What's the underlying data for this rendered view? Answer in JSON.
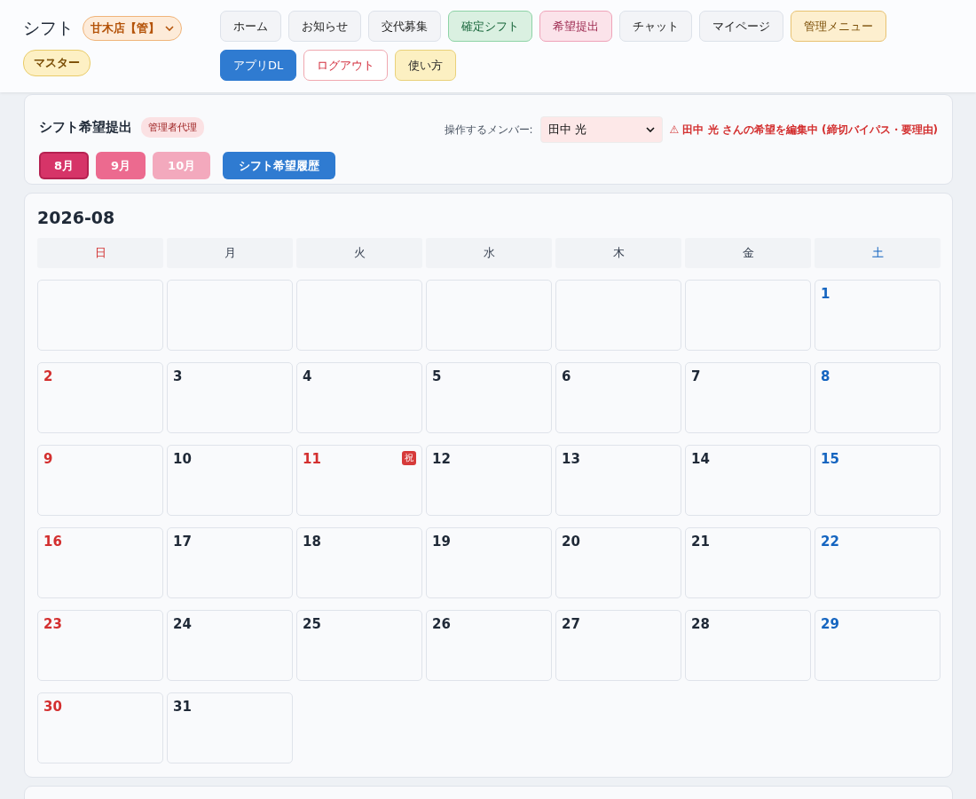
{
  "header": {
    "title": "シフト",
    "store_select": {
      "value": "甘木店【管】"
    },
    "role_badge": "マスター",
    "nav": [
      {
        "label": "ホーム",
        "kind": "plain"
      },
      {
        "label": "お知らせ",
        "kind": "plain"
      },
      {
        "label": "交代募集",
        "kind": "plain"
      },
      {
        "label": "確定シフト",
        "kind": "green"
      },
      {
        "label": "希望提出",
        "kind": "pink"
      },
      {
        "label": "チャット",
        "kind": "plain"
      },
      {
        "label": "マイページ",
        "kind": "plain"
      },
      {
        "label": "管理メニュー",
        "kind": "amber"
      },
      {
        "label": "アプリDL",
        "kind": "blue"
      },
      {
        "label": "ログアウト",
        "kind": "danger"
      },
      {
        "label": "使い方",
        "kind": "yellow"
      }
    ]
  },
  "request_panel": {
    "title": "シフト希望提出",
    "badge": "管理者代理",
    "member_label": "操作するメンバー:",
    "member_select": {
      "value": "田中 光"
    },
    "warning": "⚠ 田中 光 さんの希望を編集中 (締切バイパス・要理由)",
    "months": [
      {
        "label": "8月",
        "selected": true,
        "color": "#d63468"
      },
      {
        "label": "9月",
        "selected": false,
        "color": "#ec6a8f"
      },
      {
        "label": "10月",
        "selected": false,
        "color": "#f3a9bd"
      }
    ],
    "history_button": "シフト希望履歴"
  },
  "calendar": {
    "title": "2026-08",
    "weekdays": [
      {
        "label": "日",
        "kind": "sun"
      },
      {
        "label": "月",
        "kind": "weekday"
      },
      {
        "label": "火",
        "kind": "weekday"
      },
      {
        "label": "水",
        "kind": "weekday"
      },
      {
        "label": "木",
        "kind": "weekday"
      },
      {
        "label": "金",
        "kind": "weekday"
      },
      {
        "label": "土",
        "kind": "sat"
      }
    ],
    "weeks": [
      [
        {
          "kind": "empty"
        },
        {
          "kind": "empty"
        },
        {
          "kind": "empty"
        },
        {
          "kind": "empty"
        },
        {
          "kind": "empty"
        },
        {
          "kind": "empty"
        },
        {
          "kind": "sat",
          "day": "1"
        }
      ],
      [
        {
          "kind": "sun",
          "day": "2"
        },
        {
          "kind": "weekday",
          "day": "3"
        },
        {
          "kind": "weekday",
          "day": "4"
        },
        {
          "kind": "weekday",
          "day": "5"
        },
        {
          "kind": "weekday",
          "day": "6"
        },
        {
          "kind": "weekday",
          "day": "7"
        },
        {
          "kind": "sat",
          "day": "8"
        }
      ],
      [
        {
          "kind": "sun",
          "day": "9"
        },
        {
          "kind": "weekday",
          "day": "10"
        },
        {
          "kind": "holiday",
          "day": "11",
          "badge": "祝"
        },
        {
          "kind": "weekday",
          "day": "12"
        },
        {
          "kind": "weekday",
          "day": "13"
        },
        {
          "kind": "weekday",
          "day": "14"
        },
        {
          "kind": "sat",
          "day": "15"
        }
      ],
      [
        {
          "kind": "sun",
          "day": "16"
        },
        {
          "kind": "weekday",
          "day": "17"
        },
        {
          "kind": "weekday",
          "day": "18"
        },
        {
          "kind": "weekday",
          "day": "19"
        },
        {
          "kind": "weekday",
          "day": "20"
        },
        {
          "kind": "weekday",
          "day": "21"
        },
        {
          "kind": "sat",
          "day": "22"
        }
      ],
      [
        {
          "kind": "sun",
          "day": "23"
        },
        {
          "kind": "weekday",
          "day": "24"
        },
        {
          "kind": "weekday",
          "day": "25"
        },
        {
          "kind": "weekday",
          "day": "26"
        },
        {
          "kind": "weekday",
          "day": "27"
        },
        {
          "kind": "weekday",
          "day": "28"
        },
        {
          "kind": "sat",
          "day": "29"
        }
      ],
      [
        {
          "kind": "sun",
          "day": "30"
        },
        {
          "kind": "weekday",
          "day": "31"
        },
        {
          "kind": "none"
        },
        {
          "kind": "none"
        },
        {
          "kind": "none"
        },
        {
          "kind": "none"
        },
        {
          "kind": "none"
        }
      ]
    ]
  }
}
